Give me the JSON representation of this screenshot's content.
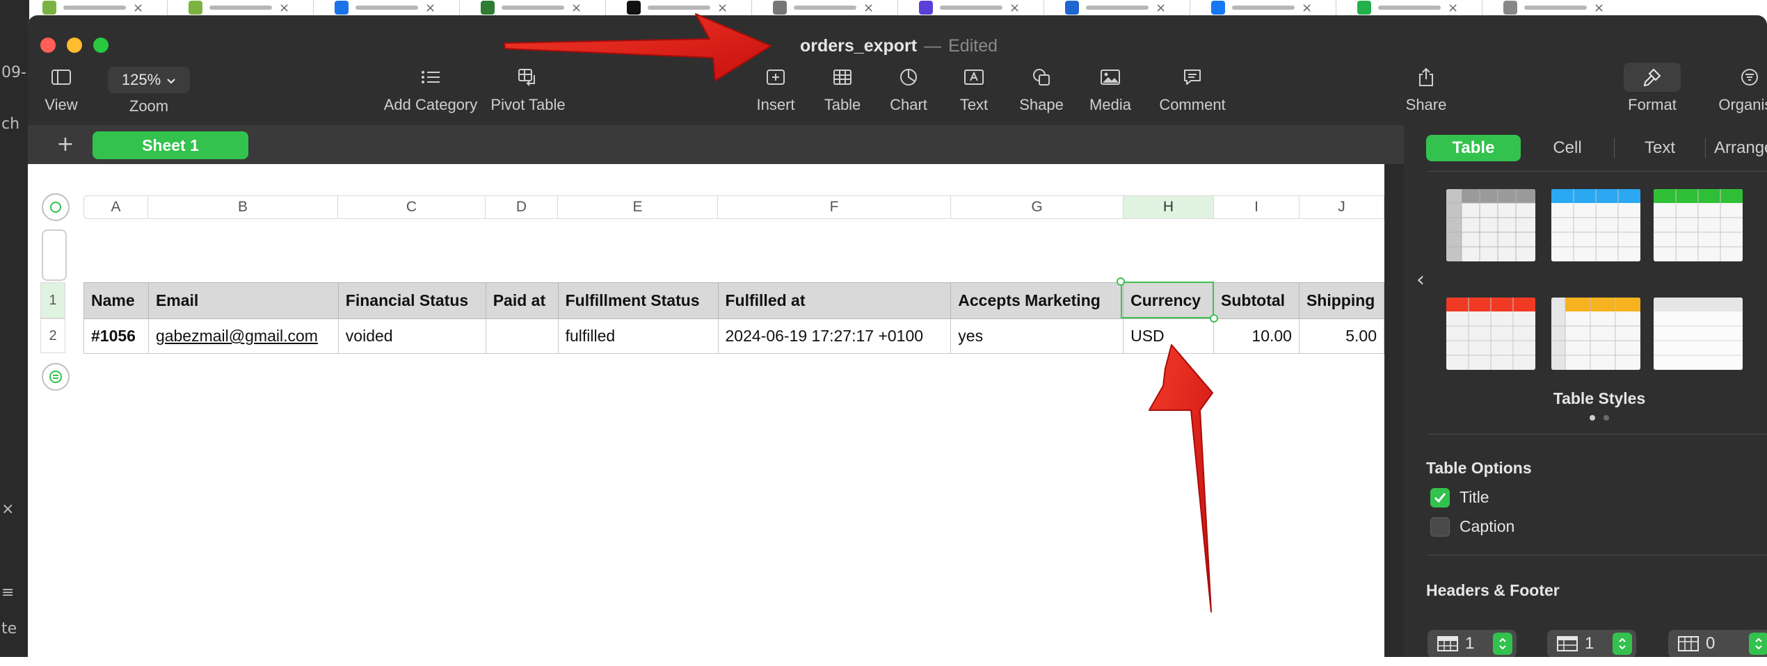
{
  "background": {
    "left_edge_labels": [
      "09-",
      "ch",
      "×",
      "≡",
      "te"
    ]
  },
  "window": {
    "title": "orders_export",
    "title_separator": "—",
    "status": "Edited"
  },
  "toolbar": {
    "view": "View",
    "zoom": "Zoom",
    "zoom_value": "125%",
    "add_category": "Add Category",
    "pivot_table": "Pivot Table",
    "insert": "Insert",
    "table": "Table",
    "chart": "Chart",
    "text": "Text",
    "shape": "Shape",
    "media": "Media",
    "comment": "Comment",
    "share": "Share",
    "format": "Format",
    "organise": "Organise"
  },
  "sheets": {
    "add_symbol": "+",
    "tabs": [
      {
        "label": "Sheet 1",
        "active": true
      }
    ]
  },
  "columns": [
    "A",
    "B",
    "C",
    "D",
    "E",
    "F",
    "G",
    "H",
    "I",
    "J"
  ],
  "selected_column": "H",
  "rows": [
    "1",
    "2"
  ],
  "table": {
    "headers": [
      "Name",
      "Email",
      "Financial Status",
      "Paid at",
      "Fulfillment Status",
      "Fulfilled at",
      "Accepts Marketing",
      "Currency",
      "Subtotal",
      "Shipping"
    ],
    "rows": [
      [
        "#1056",
        "gabezmail@gmail.com",
        "voided",
        "",
        "fulfilled",
        "2024-06-19 17:27:17 +0100",
        "yes",
        "USD",
        "10.00",
        "5.00"
      ]
    ]
  },
  "panel": {
    "tabs": [
      "Table",
      "Cell",
      "Text",
      "Arrange"
    ],
    "active_tab": "Table",
    "table_styles_label": "Table Styles",
    "style_colors": [
      "#9a9a9a",
      "#2aa8f2",
      "#2fbf36",
      "#f03a24",
      "#f7b21f",
      "#e6e6e6"
    ],
    "table_options_label": "Table Options",
    "options": [
      {
        "label": "Title",
        "checked": true
      },
      {
        "label": "Caption",
        "checked": false
      }
    ],
    "headers_footer_label": "Headers & Footer",
    "header_rows": "1",
    "header_columns": "1",
    "footer_rows": "0"
  },
  "colors": {
    "accent_green": "#33c24d",
    "annotation_red": "#e0100f"
  }
}
